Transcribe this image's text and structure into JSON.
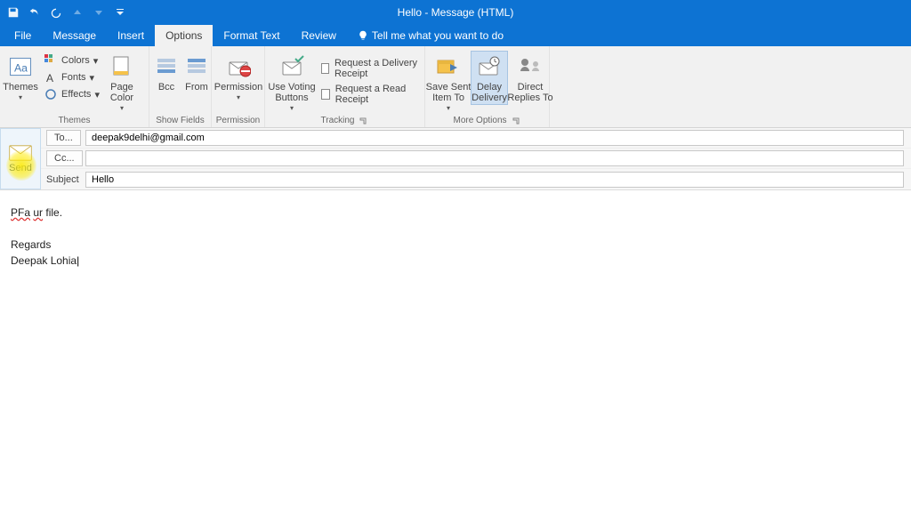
{
  "title": "Hello - Message (HTML)",
  "tabs": {
    "file": "File",
    "message": "Message",
    "insert": "Insert",
    "options": "Options",
    "format": "Format Text",
    "review": "Review",
    "tellme": "Tell me what you want to do"
  },
  "ribbon": {
    "themes": {
      "themes": "Themes",
      "colors": "Colors",
      "fonts": "Fonts",
      "effects": "Effects",
      "pagecolor": "Page\nColor",
      "group": "Themes"
    },
    "showfields": {
      "bcc": "Bcc",
      "from": "From",
      "group": "Show Fields"
    },
    "permission": {
      "permission": "Permission",
      "group": "Permission"
    },
    "tracking": {
      "voting": "Use Voting\nButtons",
      "delivery": "Request a Delivery Receipt",
      "read": "Request a Read Receipt",
      "group": "Tracking"
    },
    "more": {
      "savesent": "Save Sent\nItem To",
      "delay": "Delay\nDelivery",
      "direct": "Direct\nReplies To",
      "group": "More Options"
    }
  },
  "compose": {
    "send": "Send",
    "to_btn": "To...",
    "cc_btn": "Cc...",
    "subject_lbl": "Subject",
    "to_val": "deepak9delhi@gmail.com",
    "cc_val": "",
    "subject_val": "Hello"
  },
  "body": {
    "line1a": "PFa",
    "line1b": "ur",
    "line1c": " file.",
    "line3": "Regards",
    "line4": "Deepak Lohia"
  }
}
